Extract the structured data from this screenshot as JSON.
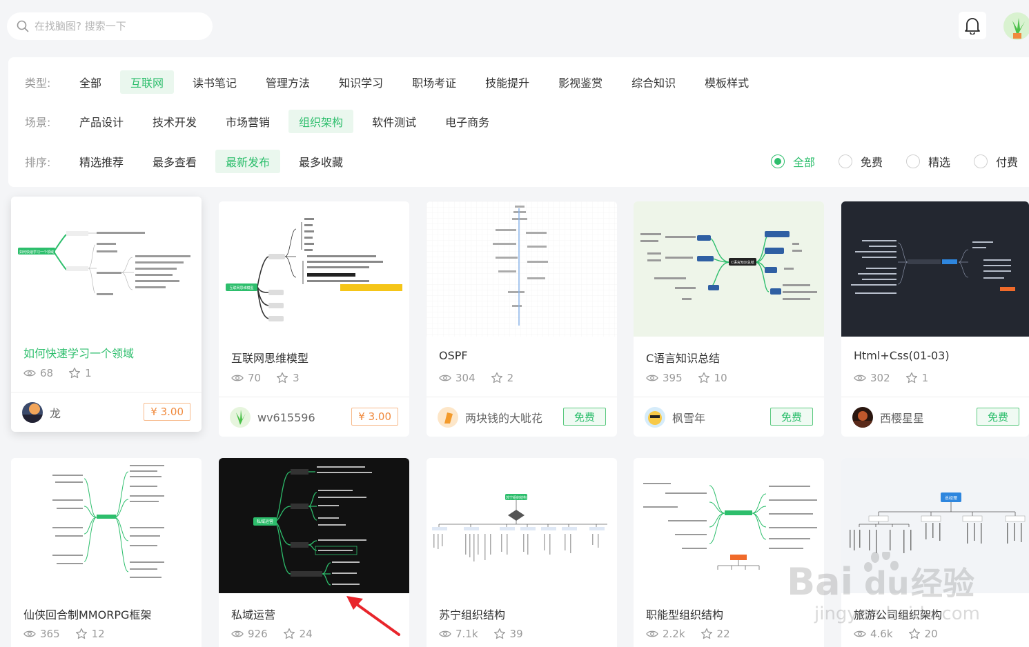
{
  "search": {
    "placeholder": "在找脑图? 搜索一下"
  },
  "filters": {
    "type": {
      "label": "类型:",
      "options": [
        "全部",
        "互联网",
        "读书笔记",
        "管理方法",
        "知识学习",
        "职场考证",
        "技能提升",
        "影视鉴赏",
        "综合知识",
        "模板样式"
      ],
      "active_index": 1
    },
    "scene": {
      "label": "场景:",
      "options": [
        "产品设计",
        "技术开发",
        "市场营销",
        "组织架构",
        "软件测试",
        "电子商务"
      ],
      "active_index": 3
    },
    "sort": {
      "label": "排序:",
      "options": [
        "精选推荐",
        "最多查看",
        "最新发布",
        "最多收藏"
      ],
      "active_index": 2
    },
    "price": {
      "options": [
        "全部",
        "免费",
        "精选",
        "付费"
      ],
      "checked_index": 0
    }
  },
  "colors": {
    "accent": "#2dbe6c",
    "price_orange": "#f08a3e",
    "dark_thumb": "#232730"
  },
  "cards": [
    {
      "title": "如何快速学习一个领域",
      "views": "68",
      "stars": "1",
      "author": "龙",
      "price": "¥ 3.00",
      "theme": "light"
    },
    {
      "title": "互联网思维模型",
      "views": "70",
      "stars": "3",
      "author": "wv615596",
      "price": "¥ 3.00",
      "theme": "light"
    },
    {
      "title": "OSPF",
      "views": "304",
      "stars": "2",
      "author": "两块钱的大呲花",
      "price": "免费",
      "theme": "grid"
    },
    {
      "title": "C语言知识总结",
      "views": "395",
      "stars": "10",
      "author": "枫雪年",
      "price": "免费",
      "theme": "mint"
    },
    {
      "title": "Html+Css(01-03)",
      "views": "302",
      "stars": "1",
      "author": "西樱星星",
      "price": "免费",
      "theme": "dark"
    },
    {
      "title": "仙侠回合制MMORPG框架",
      "views": "365",
      "stars": "12",
      "theme": "light"
    },
    {
      "title": "私域运营",
      "views": "926",
      "stars": "24",
      "theme": "black"
    },
    {
      "title": "苏宁组织结构",
      "views": "7.1k",
      "stars": "39",
      "theme": "light"
    },
    {
      "title": "职能型组织结构",
      "views": "2.2k",
      "stars": "22",
      "theme": "light"
    },
    {
      "title": "旅游公司组织架构",
      "views": "4.6k",
      "stars": "20",
      "theme": "light"
    }
  ],
  "thumb_labels": {
    "c1": "如何快速学习一个领域",
    "c2": "互联网思维模型",
    "c4": "C语言知识总结",
    "c7": "私域运营",
    "c8": "苏宁组织结构",
    "c10": "总经理"
  },
  "watermark": {
    "brand": "Bai",
    "du": "du",
    "suffix": "经验",
    "url": "jingyan.baidu.com"
  }
}
